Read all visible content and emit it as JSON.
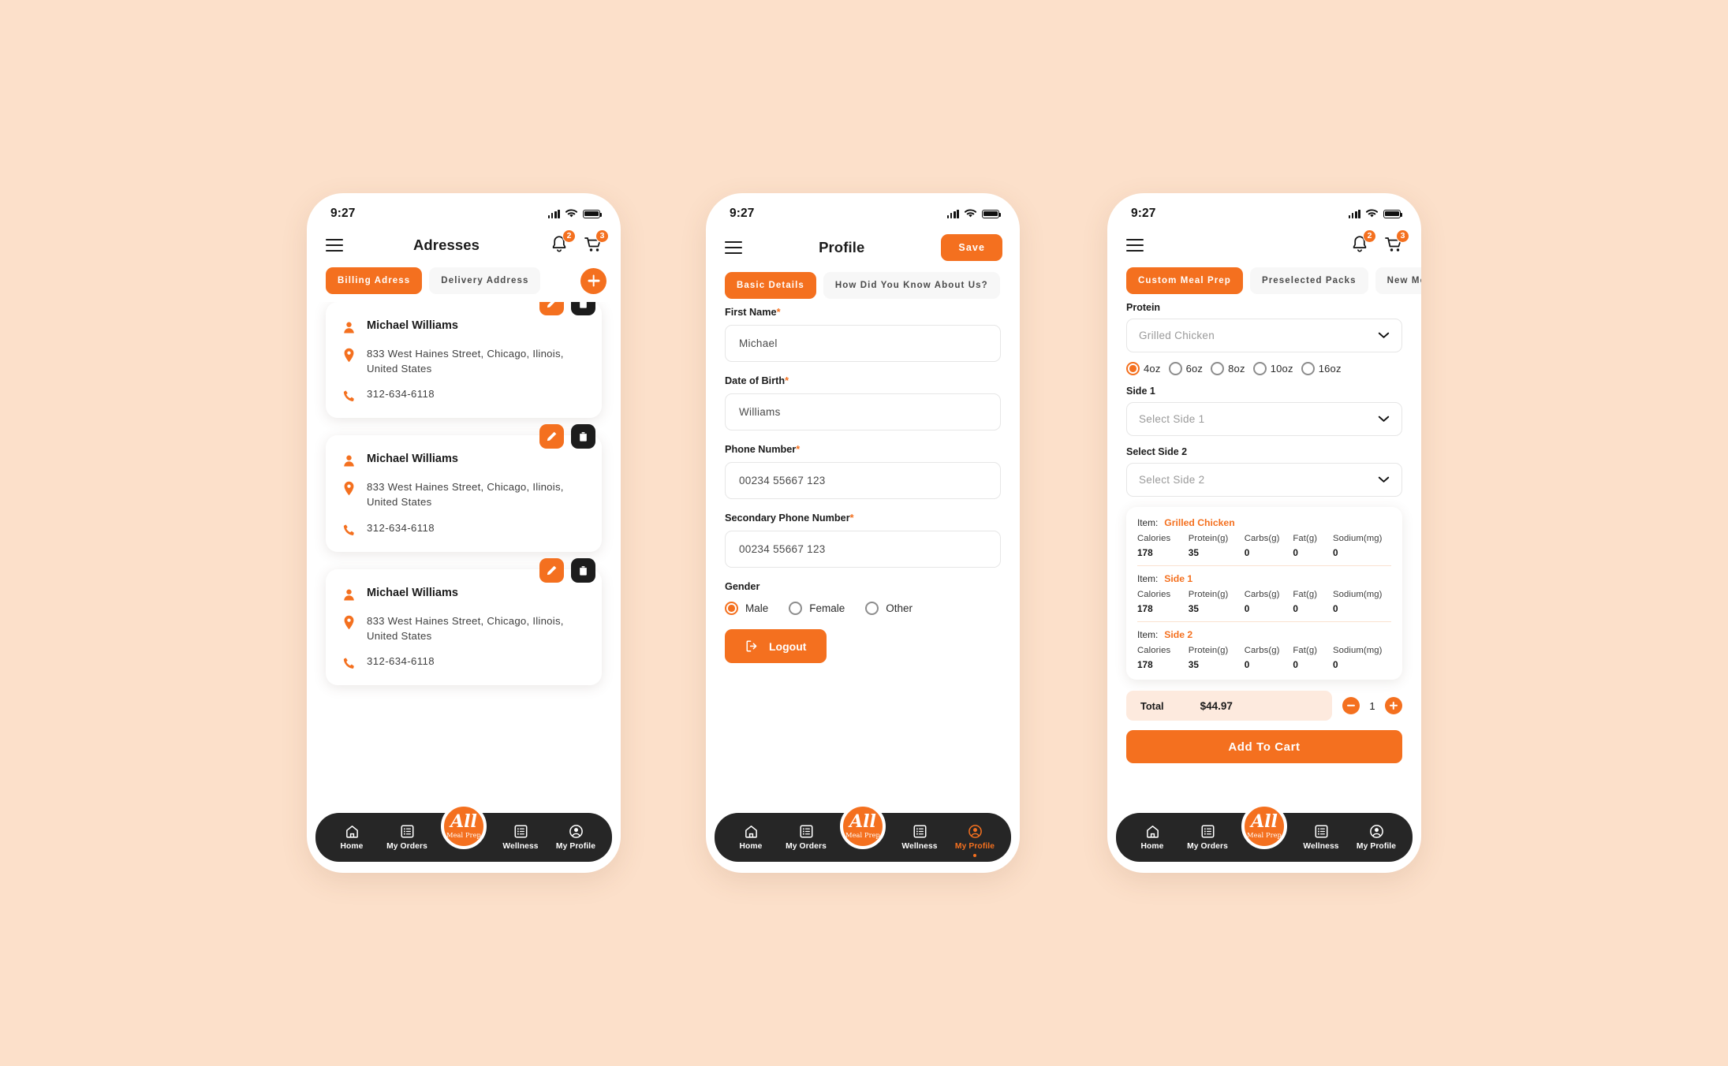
{
  "theme": {
    "accent": "#f4701f",
    "page_bg": "#fce0ca",
    "dark": "#262626"
  },
  "status_bar": {
    "time": "9:27"
  },
  "brand": {
    "logo_primary": "All",
    "logo_secondary": "Meal Prep"
  },
  "bottom_nav": {
    "items": [
      {
        "label": "Home",
        "icon": "home-icon"
      },
      {
        "label": "My Orders",
        "icon": "list-icon"
      },
      {
        "label": "Wellness",
        "icon": "list-icon"
      },
      {
        "label": "My Profile",
        "icon": "user-circle-icon"
      }
    ]
  },
  "screen_addresses": {
    "title": "Adresses",
    "notification_badge": "2",
    "cart_badge": "3",
    "tabs": [
      {
        "label": "Billing Adress",
        "active": true
      },
      {
        "label": "Delivery Address",
        "active": false
      }
    ],
    "add_button": "add-address-button",
    "cards": [
      {
        "name": "Michael Williams",
        "address": "833 West Haines Street, Chicago, Ilinois, United States",
        "phone": "312-634-6118"
      },
      {
        "name": "Michael Williams",
        "address": "833 West Haines Street, Chicago, Ilinois, United States",
        "phone": "312-634-6118"
      },
      {
        "name": "Michael Williams",
        "address": "833 West Haines Street, Chicago, Ilinois, United States",
        "phone": "312-634-6118"
      }
    ]
  },
  "screen_profile": {
    "title": "Profile",
    "save_label": "Save",
    "tabs": [
      {
        "label": "Basic Details",
        "active": true
      },
      {
        "label": "How Did You Know About Us?",
        "active": false
      }
    ],
    "fields": [
      {
        "label": "First Name",
        "required": "*",
        "value": "Michael"
      },
      {
        "label": "Date of Birth",
        "required": "*",
        "value": "Williams"
      },
      {
        "label": "Phone Number",
        "required": "*",
        "value": "00234 55667 123"
      },
      {
        "label": "Secondary Phone Number",
        "required": "*",
        "value": "00234 55667 123"
      }
    ],
    "gender": {
      "label": "Gender",
      "options": [
        {
          "label": "Male",
          "selected": true
        },
        {
          "label": "Female",
          "selected": false
        },
        {
          "label": "Other",
          "selected": false
        }
      ]
    },
    "logout_label": "Logout",
    "active_nav": "My Profile"
  },
  "screen_meal": {
    "notification_badge": "2",
    "cart_badge": "3",
    "tabs": [
      {
        "label": "Custom Meal Prep",
        "active": true
      },
      {
        "label": "Preselected Packs",
        "active": false
      },
      {
        "label": "New Menu",
        "active": false
      }
    ],
    "protein": {
      "label": "Protein",
      "value": "Grilled Chicken"
    },
    "sizes": [
      {
        "label": "4oz",
        "selected": true
      },
      {
        "label": "6oz",
        "selected": false
      },
      {
        "label": "8oz",
        "selected": false
      },
      {
        "label": "10oz",
        "selected": false
      },
      {
        "label": "16oz",
        "selected": false
      }
    ],
    "side1": {
      "label": "Side 1",
      "value": "Select Side 1"
    },
    "side2": {
      "label": "Select Side 2",
      "value": "Select Side 2"
    },
    "nutrition": {
      "item_prefix": "Item:",
      "headers": [
        "Calories",
        "Protein(g)",
        "Carbs(g)",
        "Fat(g)",
        "Sodium(mg)"
      ],
      "groups": [
        {
          "item": "Grilled Chicken",
          "values": [
            "178",
            "35",
            "0",
            "0",
            "0"
          ]
        },
        {
          "item": "Side 1",
          "values": [
            "178",
            "35",
            "0",
            "0",
            "0"
          ]
        },
        {
          "item": "Side 2",
          "values": [
            "178",
            "35",
            "0",
            "0",
            "0"
          ]
        }
      ]
    },
    "total": {
      "label": "Total",
      "value": "$44.97",
      "quantity": "1"
    },
    "add_to_cart_label": "Add To Cart"
  }
}
